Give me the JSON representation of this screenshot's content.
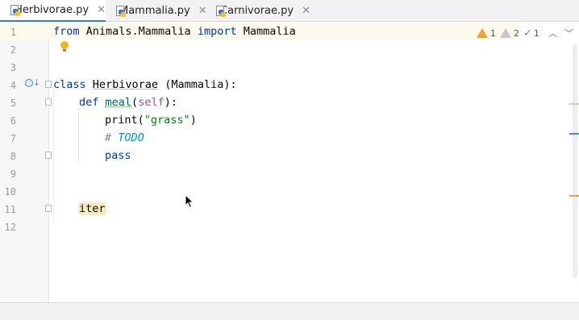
{
  "tabs": [
    {
      "label": "Herbivorae.py",
      "active": true
    },
    {
      "label": "Mammalia.py",
      "active": false
    },
    {
      "label": "Carnivorae.py",
      "active": false
    }
  ],
  "tab_close_glyph": "✕",
  "line_numbers": [
    "1",
    "2",
    "3",
    "4",
    "5",
    "6",
    "7",
    "8",
    "9",
    "10",
    "11",
    "12"
  ],
  "code": {
    "l1_from": "from",
    "l1_module": " Animals.Mammalia ",
    "l1_import": "import",
    "l1_name": " Mammalia",
    "l4_class": "class",
    "l4_name": "Herbivorae",
    "l4_rest": " (Mammalia):",
    "l5_def": "def",
    "l5_fn": "meal",
    "l5_paren_open": "(",
    "l5_self": "self",
    "l5_paren_close": "):",
    "l6_print": "print(",
    "l6_str": "\"grass\"",
    "l6_close": ")",
    "l7_hash": "# ",
    "l7_todo": "TODO",
    "l8_pass": "pass",
    "l11_iter": "iter"
  },
  "inspections": {
    "warnings": "1",
    "weak_warnings": "2",
    "ok": "1"
  },
  "colors": {
    "keyword": "#0033b3",
    "string": "#067d17",
    "self": "#94558d",
    "todo": "#008dde",
    "tab_accent": "#3d76d9",
    "warning": "#e8a33d",
    "scroll_marker_warning": "#e8a33d",
    "scroll_marker_info": "#4a8bd6"
  },
  "icons": {
    "file": "python-file-icon",
    "bulb": "intention-bulb-icon",
    "override": "overrides-method-icon",
    "warning": "warning-triangle-icon",
    "check": "check-icon",
    "up": "chevron-up-icon",
    "down": "chevron-down-icon"
  }
}
